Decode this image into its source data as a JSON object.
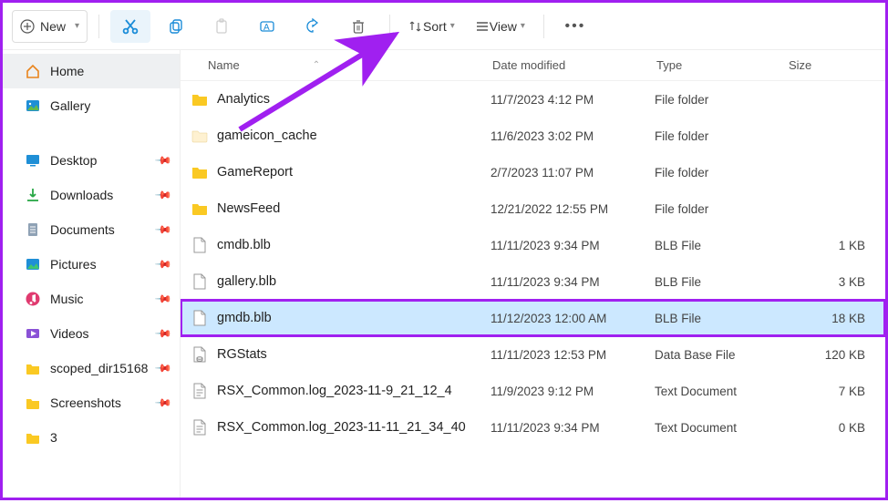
{
  "toolbar": {
    "new_label": "New",
    "sort_label": "Sort",
    "view_label": "View"
  },
  "sidebar": {
    "items": [
      {
        "label": "Home",
        "icon": "home",
        "selected": true
      },
      {
        "label": "Gallery",
        "icon": "gallery"
      }
    ],
    "quick": [
      {
        "label": "Desktop",
        "icon": "desktop",
        "pinned": true
      },
      {
        "label": "Downloads",
        "icon": "downloads",
        "pinned": true
      },
      {
        "label": "Documents",
        "icon": "documents",
        "pinned": true
      },
      {
        "label": "Pictures",
        "icon": "pictures",
        "pinned": true
      },
      {
        "label": "Music",
        "icon": "music",
        "pinned": true
      },
      {
        "label": "Videos",
        "icon": "videos",
        "pinned": true
      },
      {
        "label": "scoped_dir15168",
        "icon": "folder",
        "pinned": true
      },
      {
        "label": "Screenshots",
        "icon": "folder",
        "pinned": true
      },
      {
        "label": "3",
        "icon": "folder"
      }
    ]
  },
  "columns": {
    "name": "Name",
    "date": "Date modified",
    "type": "Type",
    "size": "Size"
  },
  "files": [
    {
      "name": "Analytics",
      "date": "11/7/2023 4:12 PM",
      "type": "File folder",
      "size": "",
      "icon": "folder-yellow"
    },
    {
      "name": "gameicon_cache",
      "date": "11/6/2023 3:02 PM",
      "type": "File folder",
      "size": "",
      "icon": "folder-pale"
    },
    {
      "name": "GameReport",
      "date": "2/7/2023 11:07 PM",
      "type": "File folder",
      "size": "",
      "icon": "folder-yellow"
    },
    {
      "name": "NewsFeed",
      "date": "12/21/2022 12:55 PM",
      "type": "File folder",
      "size": "",
      "icon": "folder-yellow"
    },
    {
      "name": "cmdb.blb",
      "date": "11/11/2023 9:34 PM",
      "type": "BLB File",
      "size": "1 KB",
      "icon": "file"
    },
    {
      "name": "gallery.blb",
      "date": "11/11/2023 9:34 PM",
      "type": "BLB File",
      "size": "3 KB",
      "icon": "file"
    },
    {
      "name": "gmdb.blb",
      "date": "11/12/2023 12:00 AM",
      "type": "BLB File",
      "size": "18 KB",
      "icon": "file",
      "selected": true
    },
    {
      "name": "RGStats",
      "date": "11/11/2023 12:53 PM",
      "type": "Data Base File",
      "size": "120 KB",
      "icon": "db"
    },
    {
      "name": "RSX_Common.log_2023-11-9_21_12_4",
      "date": "11/9/2023 9:12 PM",
      "type": "Text Document",
      "size": "7 KB",
      "icon": "text"
    },
    {
      "name": "RSX_Common.log_2023-11-11_21_34_40",
      "date": "11/11/2023 9:34 PM",
      "type": "Text Document",
      "size": "0 KB",
      "icon": "text"
    }
  ]
}
